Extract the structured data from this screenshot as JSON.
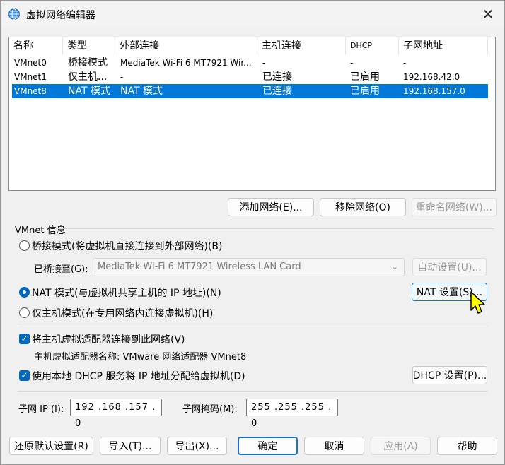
{
  "window": {
    "title": "虚拟网络编辑器",
    "close_glyph": "✕"
  },
  "list": {
    "headers": [
      "名称",
      "类型",
      "外部连接",
      "主机连接",
      "DHCP",
      "子网地址"
    ],
    "rows": [
      {
        "name": "VMnet0",
        "type": "桥接模式",
        "external": "MediaTek Wi-Fi 6 MT7921 Wir...",
        "host": "-",
        "dhcp": "-",
        "subnet": "-"
      },
      {
        "name": "VMnet1",
        "type": "仅主机...",
        "external": "-",
        "host": "已连接",
        "dhcp": "已启用",
        "subnet": "192.168.42.0"
      },
      {
        "name": "VMnet8",
        "type": "NAT 模式",
        "external": "NAT 模式",
        "host": "已连接",
        "dhcp": "已启用",
        "subnet": "192.168.157.0"
      }
    ],
    "selected_index": 2
  },
  "list_buttons": {
    "add": "添加网络(E)...",
    "remove": "移除网络(O)",
    "rename": "重命名网络(W)..."
  },
  "info": {
    "group_title": "VMnet 信息",
    "bridged_label": "桥接模式(将虚拟机直接连接到外部网络)(B)",
    "bridged_to_label": "已桥接至(G):",
    "bridged_to_value": "MediaTek Wi-Fi 6 MT7921 Wireless LAN Card",
    "auto_settings": "自动设置(U)...",
    "nat_label": "NAT 模式(与虚拟机共享主机的 IP 地址)(N)",
    "nat_settings": "NAT 设置(S)...",
    "hostonly_label": "仅主机模式(在专用网络内连接虚拟机)(H)",
    "selected_mode": "nat",
    "connect_adapter_label": "将主机虚拟适配器连接到此网络(V)",
    "adapter_name_label": "主机虚拟适配器名称: VMware 网络适配器 VMnet8",
    "dhcp_label": "使用本地 DHCP 服务将 IP 地址分配给虚拟机(D)",
    "dhcp_settings": "DHCP 设置(P)...",
    "subnet_ip_label": "子网 IP (I):",
    "subnet_ip_value": "192 .168 .157 . 0",
    "subnet_mask_label": "子网掩码(M):",
    "subnet_mask_value": "255 .255 .255 . 0"
  },
  "footer": {
    "restore": "还原默认设置(R)",
    "import": "导入(T)...",
    "export": "导出(X)...",
    "ok": "确定",
    "cancel": "取消",
    "apply": "应用(A)",
    "help": "帮助"
  },
  "colors": {
    "accent": "#0078d7",
    "check": "#0067c0",
    "cursor": "#ffff00"
  },
  "icons": {
    "app": "network-globe-icon",
    "close": "close-icon",
    "dropdown": "chevron-down-icon",
    "cursor": "mouse-pointer-icon"
  }
}
